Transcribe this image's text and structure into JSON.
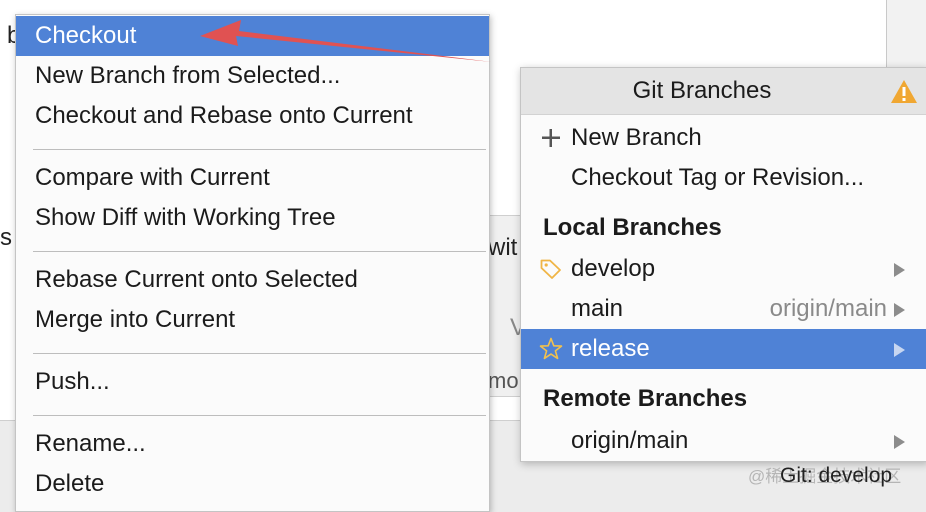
{
  "background": {
    "fragment_top": "b",
    "fragment_left": "s",
    "fragment_mid": "wit",
    "fragment_v": "V",
    "fragment_mo": "mo"
  },
  "context_menu": {
    "items": [
      {
        "label": "Checkout",
        "selected": true
      },
      {
        "label": "New Branch from Selected..."
      },
      {
        "label": "Checkout and Rebase onto Current"
      },
      {
        "label": "Compare with Current"
      },
      {
        "label": "Show Diff with Working Tree"
      },
      {
        "label": "Rebase Current onto Selected"
      },
      {
        "label": "Merge into Current"
      },
      {
        "label": "Push..."
      },
      {
        "label": "Rename..."
      },
      {
        "label": "Delete"
      }
    ]
  },
  "git_popup": {
    "title": "Git Branches",
    "warning_icon": "warning-triangle",
    "new_branch": "New Branch",
    "checkout_tag": "Checkout Tag or Revision...",
    "local_section": "Local Branches",
    "local_branches": [
      {
        "name": "develop",
        "icon": "tag-icon",
        "tracking": ""
      },
      {
        "name": "main",
        "icon": "",
        "tracking": "origin/main"
      },
      {
        "name": "release",
        "icon": "star-icon",
        "tracking": "",
        "selected": true
      }
    ],
    "remote_section": "Remote Branches",
    "remote_branches": [
      {
        "name": "origin/main"
      }
    ]
  },
  "status_bar": {
    "git_status": "Git: develop",
    "watermark": "@稀土掘金技术社区"
  },
  "colors": {
    "selection": "#4f82d6",
    "annotation_arrow": "#e05252",
    "warning": "#f0a732"
  }
}
